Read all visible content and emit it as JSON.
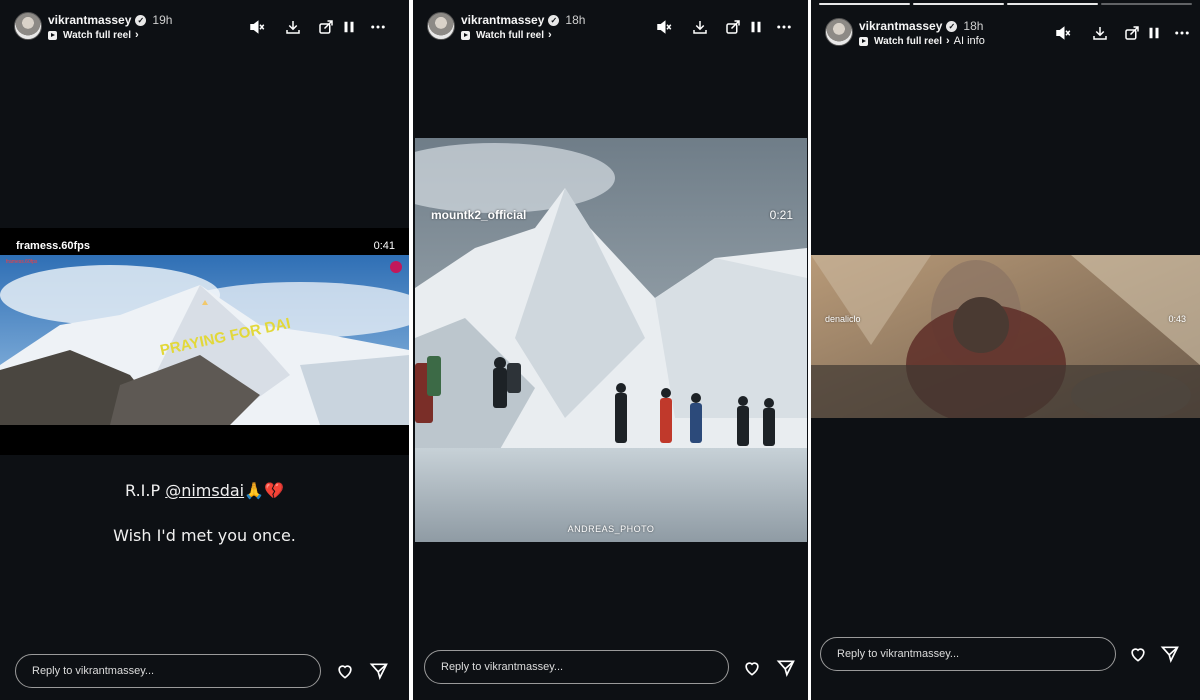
{
  "panels": [
    {
      "username": "vikrantmassey",
      "time": "19h",
      "watch_label": "Watch full reel",
      "reel": {
        "account": "framess.60fps",
        "duration": "0:41",
        "watermark": "PRAYING FOR DAI",
        "corner_label": "framess.60fps"
      },
      "caption_line1_prefix": "R.I.P ",
      "caption_mention": "@nimsdai",
      "caption_emoji": "🙏💔",
      "caption_line2": "Wish I'd met you once.",
      "reply_placeholder": "Reply to vikrantmassey..."
    },
    {
      "username": "vikrantmassey",
      "time": "18h",
      "watch_label": "Watch full reel",
      "reel": {
        "account": "mountk2_official",
        "duration": "0:21",
        "credit": "ANDREAS_PHOTO"
      },
      "reply_placeholder": "Reply to vikrantmassey..."
    },
    {
      "username": "vikrantmassey",
      "time": "18h",
      "watch_label": "Watch full reel",
      "ai_info": "AI info",
      "reel": {
        "account": "denaliclo",
        "duration": "0:43"
      },
      "reply_placeholder": "Reply to vikrantmassey..."
    }
  ],
  "icons": [
    "mute-icon",
    "download-icon",
    "share-story-icon",
    "pause-icon",
    "more-icon",
    "heart-icon",
    "send-icon",
    "verified-badge-icon",
    "reel-icon"
  ]
}
